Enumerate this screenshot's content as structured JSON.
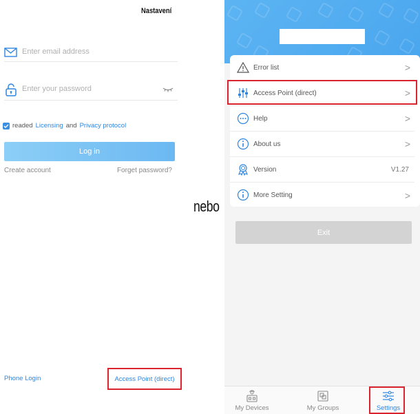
{
  "left_screen": {
    "top_label": "Nastavení",
    "email_placeholder": "Enter email address",
    "password_placeholder": "Enter your password",
    "agree_prefix": "readed",
    "licensing_link": "Licensing",
    "and_text": "and",
    "privacy_link": "Privacy protocol",
    "login_label": "Log in",
    "create_account": "Create account",
    "forget_password": "Forget password?",
    "phone_login": "Phone Login",
    "access_point": "Access Point (direct)"
  },
  "divider_word": "nebo",
  "right_screen": {
    "menu": [
      {
        "label": "Error list",
        "icon": "warning-icon",
        "trail": ">"
      },
      {
        "label": "Access Point (direct)",
        "icon": "sliders-icon",
        "trail": ">"
      },
      {
        "label": "Help",
        "icon": "chat-dots-icon",
        "trail": ">"
      },
      {
        "label": "About us",
        "icon": "info-icon",
        "trail": ">"
      },
      {
        "label": "Version",
        "icon": "award-icon",
        "value": "V1.27"
      },
      {
        "label": "More Setting",
        "icon": "info-icon",
        "trail": ">"
      }
    ],
    "exit_label": "Exit",
    "tabs": [
      {
        "label": "My Devices",
        "icon": "device-icon"
      },
      {
        "label": "My Groups",
        "icon": "groups-icon"
      },
      {
        "label": "Settings",
        "icon": "settings-sliders-icon"
      }
    ]
  },
  "colors": {
    "accent": "#2d86e0",
    "highlight": "#d9232e",
    "header": "#4aa6ee"
  }
}
